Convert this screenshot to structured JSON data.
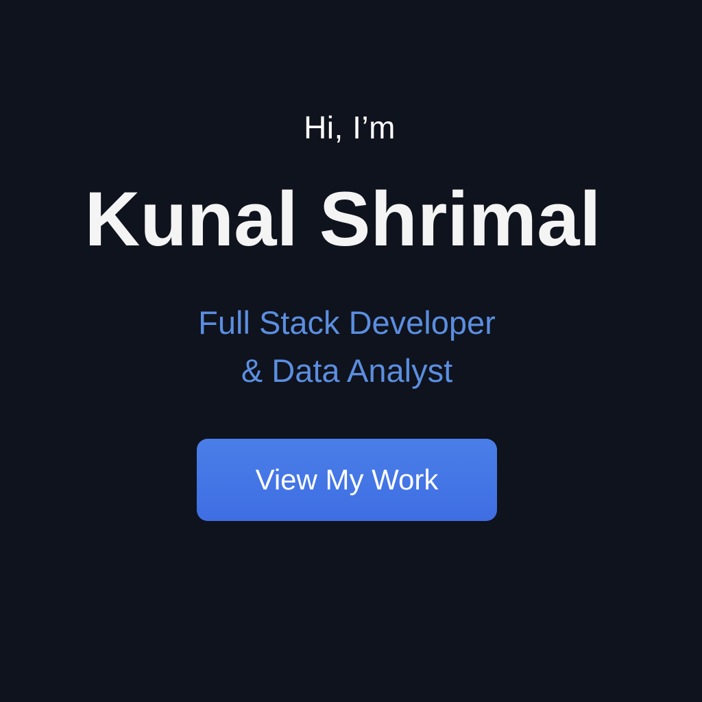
{
  "hero": {
    "greeting": "Hi, I’m",
    "name": "Kunal Shrimal",
    "subtitle_line1": "Full Stack Developer",
    "subtitle_line2": "& Data Analyst",
    "cta_label": "View My Work"
  },
  "colors": {
    "background": "#0f131d",
    "text": "#ffffff",
    "accent_text": "#5b8ee0",
    "button": "#4476e6"
  }
}
